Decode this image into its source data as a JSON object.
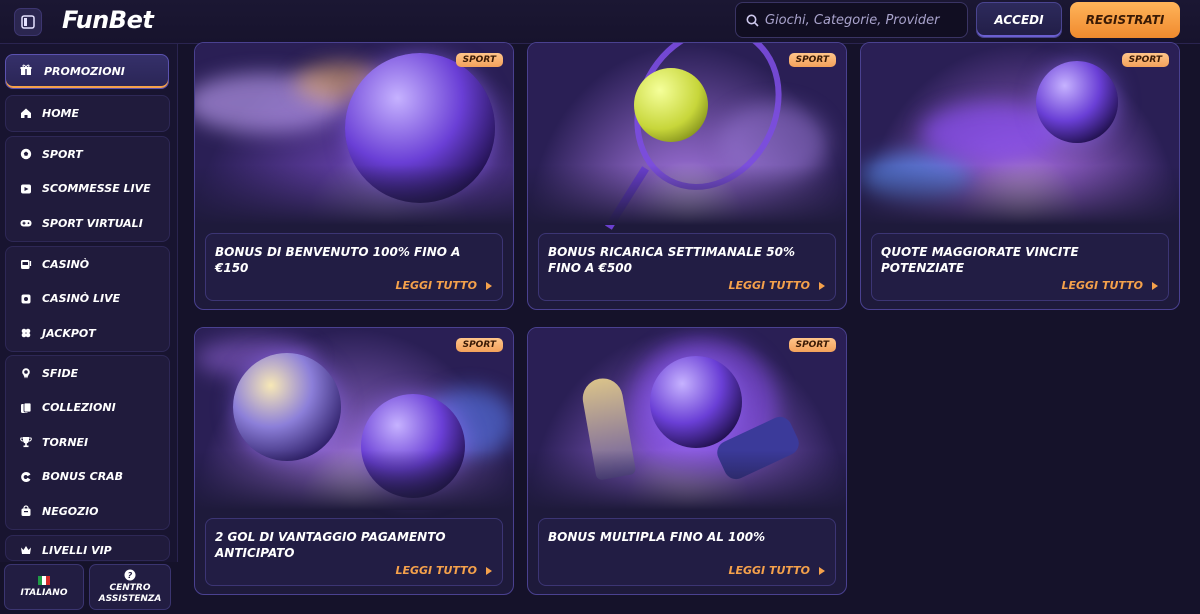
{
  "header": {
    "logo": "FunBet",
    "search_placeholder": "Giochi, Categorie, Provider",
    "login_label": "ACCEDI",
    "register_label": "REGISTRATI"
  },
  "sidebar": {
    "promo_label": "PROMOZIONI",
    "home_label": "HOME",
    "sport_items": [
      "SPORT",
      "SCOMMESSE LIVE",
      "SPORT VIRTUALI"
    ],
    "casino_items": [
      "CASINÒ",
      "CASINÒ LIVE",
      "JACKPOT"
    ],
    "extra_items": [
      "SFIDE",
      "COLLEZIONI",
      "TORNEI",
      "BONUS CRAB",
      "NEGOZIO"
    ],
    "vip_label": "LIVELLI VIP",
    "language_label": "ITALIANO",
    "help_label_1": "CENTRO",
    "help_label_2": "ASSISTENZA"
  },
  "promotions": [
    {
      "badge": "SPORT",
      "title": "BONUS DI BENVENUTO 100% FINO A €150",
      "more": "LEGGI TUTTO"
    },
    {
      "badge": "SPORT",
      "title": "BONUS RICARICA SETTIMANALE 50% FINO A €500",
      "more": "LEGGI TUTTO"
    },
    {
      "badge": "SPORT",
      "title": "QUOTE MAGGIORATE VINCITE POTENZIATE",
      "more": "LEGGI TUTTO"
    },
    {
      "badge": "SPORT",
      "title": "2 GOL DI VANTAGGIO PAGAMENTO ANTICIPATO",
      "more": "LEGGI TUTTO"
    },
    {
      "badge": "SPORT",
      "title": "BONUS MULTIPLA FINO AL 100%",
      "more": "LEGGI TUTTO"
    }
  ],
  "colors": {
    "accent": "#f5a14b",
    "background": "#15122a",
    "card": "#1e1a3b",
    "brand_purple": "#6a3fd6"
  }
}
